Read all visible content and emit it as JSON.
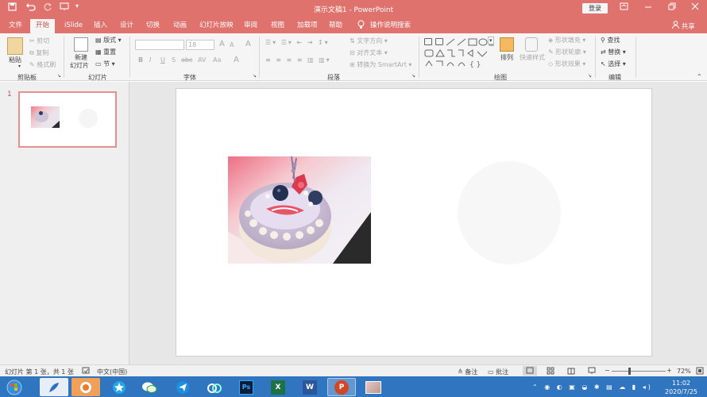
{
  "window": {
    "title": "演示文稿1  -  PowerPoint",
    "login_label": "登录",
    "accent": "#e0726e",
    "quick_access": [
      "save-icon",
      "undo-icon",
      "redo-icon",
      "present-icon",
      "customize-icon"
    ],
    "controls": [
      "ribbon-display-icon",
      "minimize-icon",
      "restore-icon",
      "close-icon"
    ]
  },
  "tabs": [
    {
      "label": "文件"
    },
    {
      "label": "开始",
      "active": true
    },
    {
      "label": "iSlide"
    },
    {
      "label": "插入"
    },
    {
      "label": "设计"
    },
    {
      "label": "切换"
    },
    {
      "label": "动画"
    },
    {
      "label": "幻灯片放映"
    },
    {
      "label": "审阅"
    },
    {
      "label": "视图"
    },
    {
      "label": "加载项"
    },
    {
      "label": "帮助"
    },
    {
      "label": "操作说明搜索"
    }
  ],
  "share_label": "共享",
  "ribbon": {
    "clipboard": {
      "label": "剪贴板",
      "paste": "粘贴",
      "cut": "剪切",
      "copy": "复制",
      "format_painter": "格式刷"
    },
    "slides": {
      "label": "幻灯片",
      "new_slide_1": "新建",
      "new_slide_2": "幻灯片",
      "layout": "版式",
      "reset": "重置",
      "section": "节"
    },
    "font": {
      "label": "字体",
      "font_size": "18",
      "bold": "B",
      "italic": "I",
      "underline": "U",
      "shadow": "S",
      "strike": "abc",
      "spacing": "AV",
      "case": "Aa",
      "grow": "A",
      "shrink": "A",
      "clear": "A",
      "color": "A"
    },
    "paragraph": {
      "label": "段落",
      "text_direction": "文字方向",
      "align_text": "对齐文本",
      "smartart": "转换为 SmartArt"
    },
    "drawing": {
      "label": "绘图",
      "arrange": "排列",
      "quick_styles": "快速样式",
      "shape_fill": "形状填充",
      "shape_outline": "形状轮廓",
      "shape_effects": "形状效果"
    },
    "editing": {
      "label": "编辑",
      "find": "查找",
      "replace": "替换",
      "select": "选择"
    }
  },
  "slides_panel": {
    "number": "1"
  },
  "status": {
    "slide_info": "幻灯片 第 1 张，共 1 张",
    "language": "中文(中国)",
    "notes": "备注",
    "comments": "批注",
    "zoom": "72%",
    "zoom_minus": "−",
    "zoom_plus": "+"
  },
  "taskbar": {
    "apps": [
      "start-icon",
      "feather-app-icon",
      "fox-browser-icon",
      "star-app-icon",
      "wechat-icon",
      "paper-plane-icon",
      "cloud-app-icon",
      "photoshop-icon",
      "excel-icon",
      "word-icon",
      "powerpoint-icon",
      "image-viewer-icon"
    ],
    "ps": "Ps",
    "excel": "X",
    "word": "W",
    "ppt": "P",
    "time": "11:02",
    "date": "2020/7/25"
  }
}
